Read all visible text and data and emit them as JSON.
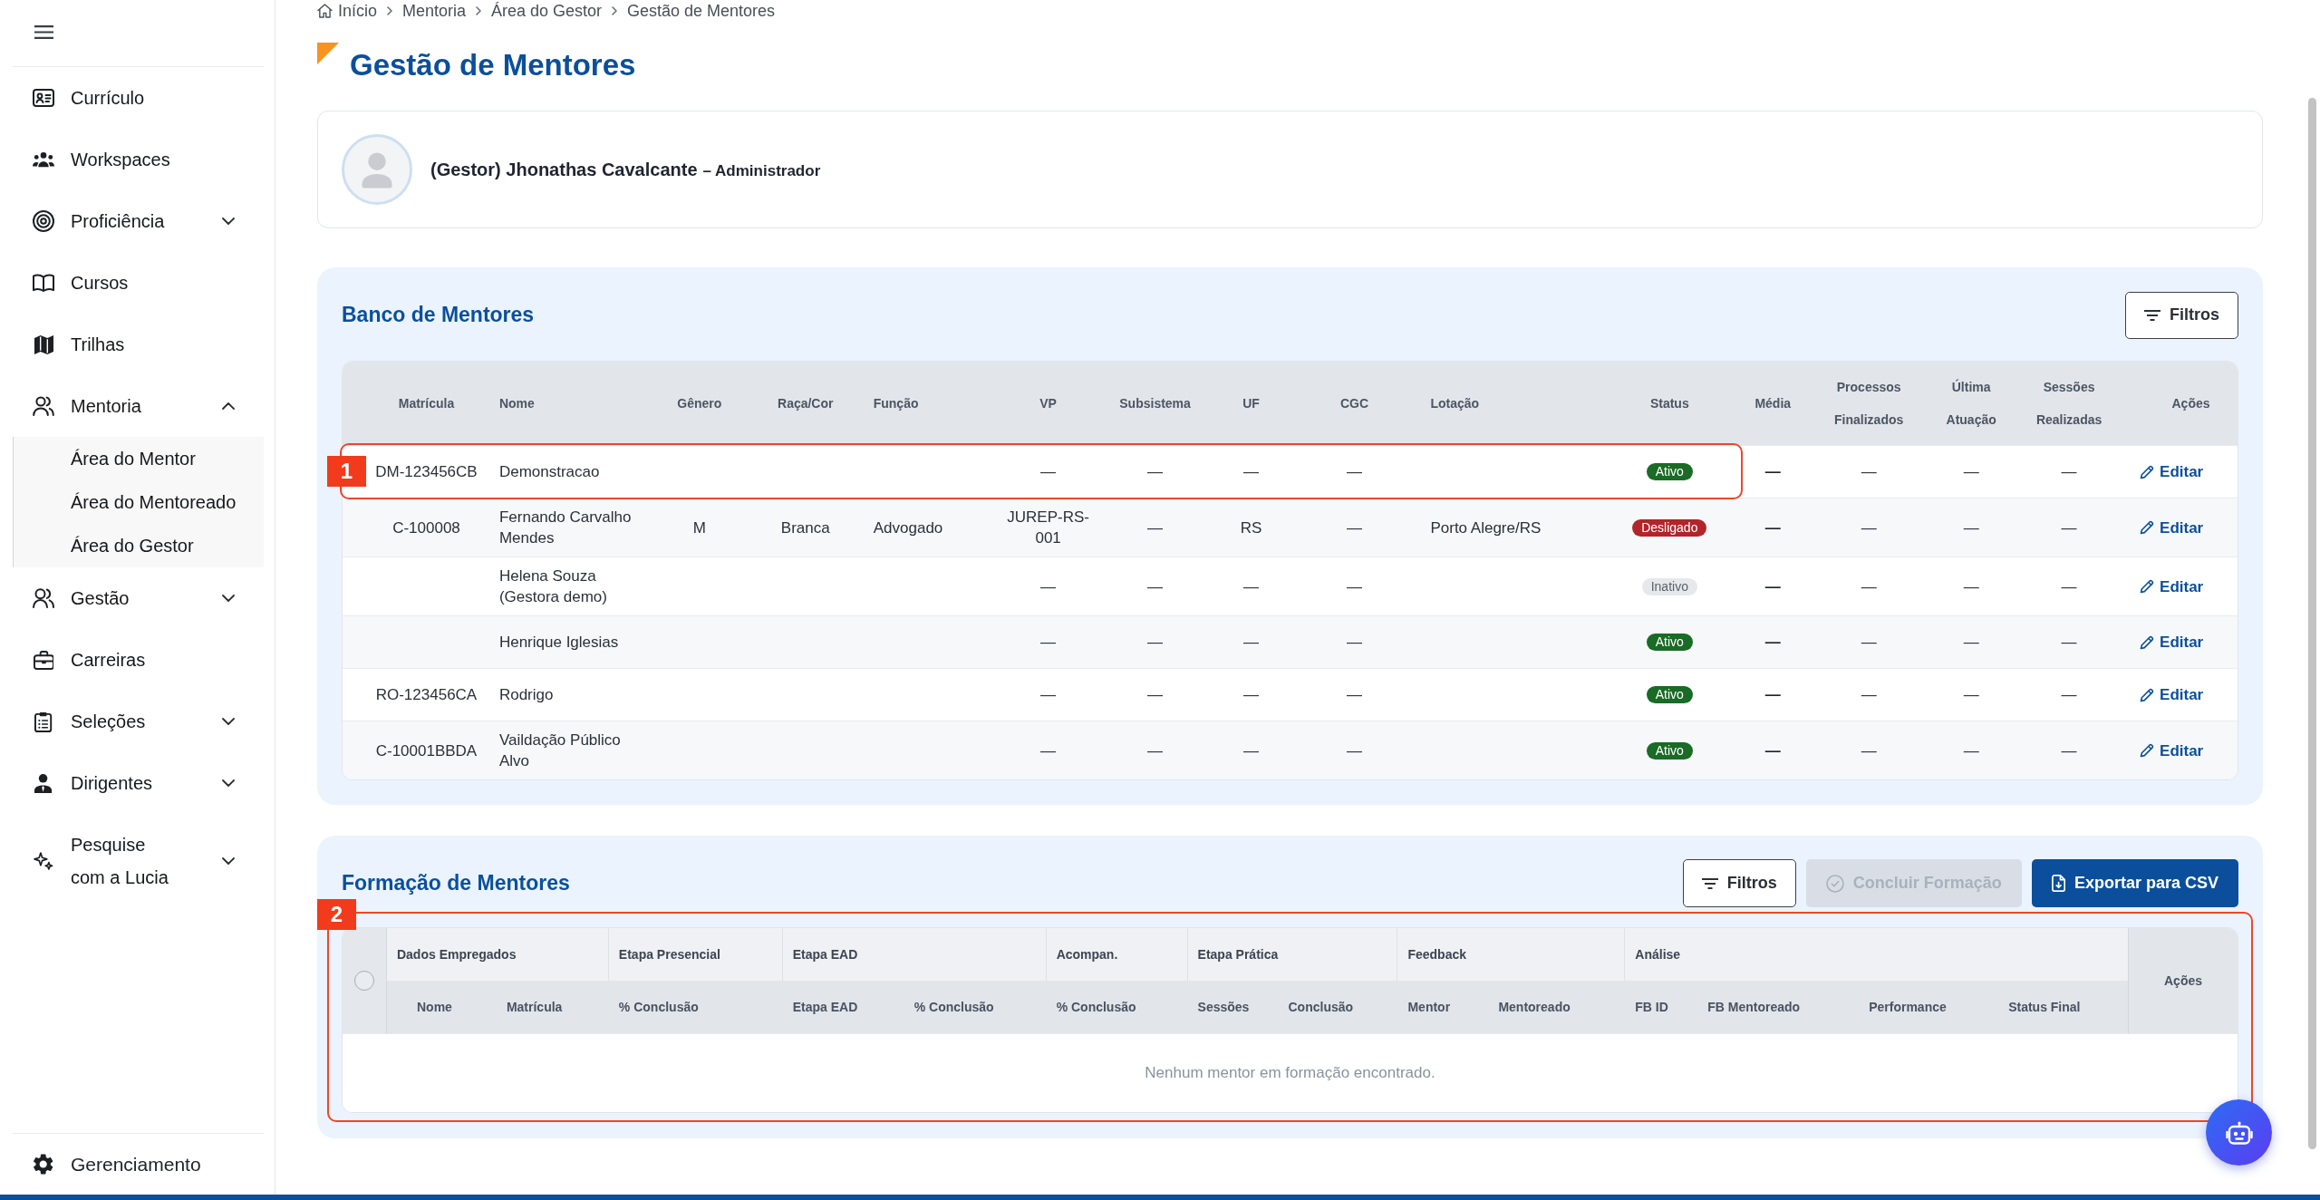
{
  "sidebar": {
    "items": [
      {
        "label": "Currículo"
      },
      {
        "label": "Workspaces"
      },
      {
        "label": "Proficiência",
        "expanded": false
      },
      {
        "label": "Cursos"
      },
      {
        "label": "Trilhas"
      },
      {
        "label": "Mentoria",
        "expanded": true,
        "children": [
          {
            "label": "Área do Mentor"
          },
          {
            "label": "Área do Mentoreado"
          },
          {
            "label": "Área do Gestor"
          }
        ]
      },
      {
        "label": "Gestão",
        "expanded": false
      },
      {
        "label": "Carreiras"
      },
      {
        "label": "Seleções",
        "expanded": false
      },
      {
        "label": "Dirigentes",
        "expanded": false
      },
      {
        "label": "Pesquise com a Lucia",
        "expanded": false
      }
    ],
    "footer_item": {
      "label": "Gerenciamento"
    }
  },
  "breadcrumb": [
    "Início",
    "Mentoria",
    "Área do Gestor",
    "Gestão de Mentores"
  ],
  "page_title": "Gestão de Mentores",
  "profile": {
    "name": "(Gestor) Jhonathas Cavalcante",
    "role": "– Administrador"
  },
  "banco": {
    "title": "Banco de Mentores",
    "filter_button": "Filtros",
    "columns": [
      "Matrícula",
      "Nome",
      "Gênero",
      "Raça/Cor",
      "Função",
      "VP",
      "Subsistema",
      "UF",
      "CGC",
      "Lotação",
      "Status",
      "Média",
      "Processos Finalizados",
      "Última Atuação",
      "Sessões Realizadas",
      "Ações"
    ],
    "rows": [
      {
        "callout": "1",
        "matricula": "DM-123456CB",
        "nome": "Demonstracao",
        "vp": "—",
        "subsistema": "—",
        "uf": "—",
        "cgc": "—",
        "status": {
          "label": "Ativo",
          "kind": "active"
        },
        "media": "—",
        "processos_finalizados": "—",
        "ultima_atuacao": "—",
        "sessoes_realizadas": "—",
        "action": "Editar"
      },
      {
        "matricula": "C-100008",
        "nome": "Fernando Carvalho Mendes",
        "genero": "M",
        "raca_cor": "Branca",
        "funcao": "Advogado",
        "vp": "JUREP-RS-001",
        "subsistema": "—",
        "uf": "RS",
        "cgc": "—",
        "lotacao": "Porto Alegre/RS",
        "status": {
          "label": "Desligado",
          "kind": "dismissed"
        },
        "media": "—",
        "processos_finalizados": "—",
        "ultima_atuacao": "—",
        "sessoes_realizadas": "—",
        "action": "Editar"
      },
      {
        "nome": "Helena Souza (Gestora demo)",
        "vp": "—",
        "subsistema": "—",
        "uf": "—",
        "cgc": "—",
        "status": {
          "label": "Inativo",
          "kind": "inactive"
        },
        "media": "—",
        "processos_finalizados": "—",
        "ultima_atuacao": "—",
        "sessoes_realizadas": "—",
        "action": "Editar"
      },
      {
        "nome": "Henrique Iglesias",
        "vp": "—",
        "subsistema": "—",
        "uf": "—",
        "cgc": "—",
        "status": {
          "label": "Ativo",
          "kind": "active"
        },
        "media": "—",
        "processos_finalizados": "—",
        "ultima_atuacao": "—",
        "sessoes_realizadas": "—",
        "action": "Editar"
      },
      {
        "matricula": "RO-123456CA",
        "nome": "Rodrigo",
        "vp": "—",
        "subsistema": "—",
        "uf": "—",
        "cgc": "—",
        "status": {
          "label": "Ativo",
          "kind": "active"
        },
        "media": "—",
        "processos_finalizados": "—",
        "ultima_atuacao": "—",
        "sessoes_realizadas": "—",
        "action": "Editar"
      },
      {
        "matricula": "C-10001BBDA",
        "nome": "Vaildação Público Alvo",
        "vp": "—",
        "subsistema": "—",
        "uf": "—",
        "cgc": "—",
        "status": {
          "label": "Ativo",
          "kind": "active"
        },
        "media": "—",
        "processos_finalizados": "—",
        "ultima_atuacao": "—",
        "sessoes_realizadas": "—",
        "action": "Editar"
      }
    ]
  },
  "formacao": {
    "title": "Formação de Mentores",
    "buttons": [
      {
        "label": "Filtros",
        "kind": "outline",
        "disabled": false
      },
      {
        "label": "Concluir Formação",
        "kind": "primary",
        "disabled": true
      },
      {
        "label": "Exportar para CSV",
        "kind": "primary",
        "disabled": false
      }
    ],
    "table": {
      "callout": "2",
      "select_all": {
        "checked": false
      },
      "groups": [
        {
          "label": "Dados Empregados",
          "columns": [
            "Nome",
            "Matrícula"
          ]
        },
        {
          "label": "Etapa Presencial",
          "columns": [
            "% Conclusão"
          ]
        },
        {
          "label": "Etapa EAD",
          "columns": [
            "Etapa EAD",
            "% Conclusão"
          ]
        },
        {
          "label": "Acompan.",
          "columns": [
            "% Conclusão"
          ]
        },
        {
          "label": "Etapa Prática",
          "columns": [
            "Sessões",
            "Conclusão"
          ]
        },
        {
          "label": "Feedback",
          "columns": [
            "Mentor",
            "Mentoreado"
          ]
        },
        {
          "label": "Análise",
          "columns": [
            "FB ID",
            "FB Mentoreado",
            "Performance",
            "Status Final"
          ]
        }
      ],
      "actions_column": "Ações",
      "empty_message": "Nenhum mentor em formação encontrado."
    }
  }
}
